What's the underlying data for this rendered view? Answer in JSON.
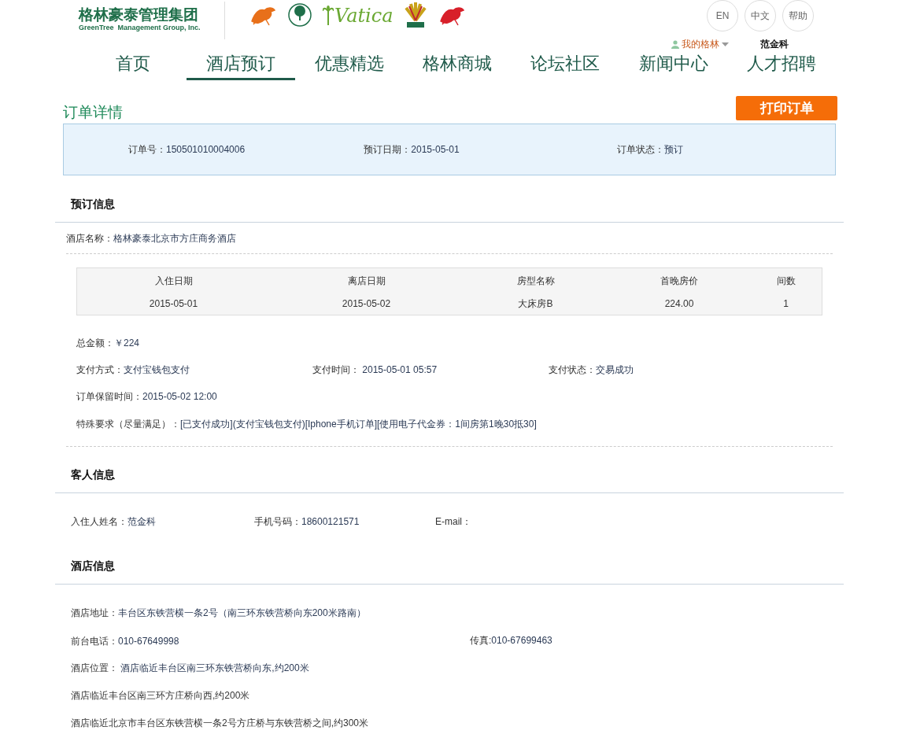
{
  "header": {
    "logo": {
      "title": "格林豪泰管理集团",
      "subtitle": "GreenTree  Management Group, Inc."
    },
    "brands": [
      {
        "kind": "dragon",
        "color": "#e8701a"
      },
      {
        "kind": "tree",
        "color": "#1f6f4a"
      },
      {
        "kind": "vatica",
        "color": "#6aa832",
        "text": "Vatica"
      },
      {
        "kind": "fan",
        "color": "#c9a21a"
      },
      {
        "kind": "dragon",
        "color": "#d8202a"
      }
    ],
    "lang_buttons": [
      "EN",
      "中文",
      "帮助"
    ],
    "user_menu": "我的格林",
    "user_name": "范金科"
  },
  "nav": [
    {
      "label": "首页",
      "selected": false
    },
    {
      "label": "酒店预订",
      "selected": true
    },
    {
      "label": "优惠精选",
      "selected": false
    },
    {
      "label": "格林商城",
      "selected": false
    },
    {
      "label": "论坛社区",
      "selected": false
    },
    {
      "label": "新闻中心",
      "selected": false
    },
    {
      "label": "人才招聘",
      "selected": false
    }
  ],
  "page_title": "订单详情",
  "print_button": "打印订单",
  "summary": [
    {
      "label": "订单号：",
      "value": "150501010004006"
    },
    {
      "label": "预订日期：",
      "value": "2015-05-01"
    },
    {
      "label": "订单状态：",
      "value": "预订"
    }
  ],
  "booking": {
    "heading": "预订信息",
    "hotel_name": {
      "label": "酒店名称：",
      "value": "格林豪泰北京市方庄商务酒店"
    },
    "table": {
      "columns": [
        "入住日期",
        "离店日期",
        "房型名称",
        "首晚房价",
        "间数"
      ],
      "rows": [
        [
          "2015-05-01",
          "2015-05-02",
          "大床房B",
          "224.00",
          "1"
        ]
      ]
    },
    "total": {
      "label": "总金额：",
      "value": "￥224"
    },
    "payment": [
      {
        "label": "支付方式：",
        "value": "支付宝钱包支付"
      },
      {
        "label": "支付时间：",
        "value": " 2015-05-01 05:57"
      },
      {
        "label": "支付状态：",
        "value": "交易成功"
      }
    ],
    "hold_time": {
      "label": "订单保留时间：",
      "value": "2015-05-02 12:00"
    },
    "special": {
      "label": "特殊要求（尽量满足）：",
      "value": "[已支付成功](支付宝钱包支付)[Iphone手机订单][使用电子代金券：1间房第1晚30抵30]"
    }
  },
  "guest": {
    "heading": "客人信息",
    "fields": [
      {
        "label": "入住人姓名：",
        "value": "范金科"
      },
      {
        "label": "手机号码：",
        "value": "18600121571"
      },
      {
        "label": "E-mail："
      }
    ]
  },
  "hotel": {
    "heading": "酒店信息",
    "address": {
      "label": "酒店地址：",
      "value": "丰台区东铁营横一条2号（南三环东铁营桥向东200米路南）"
    },
    "phone": {
      "label": "前台电话：",
      "value": "010-67649998"
    },
    "fax": {
      "label": "传真:",
      "value": "010-67699463"
    },
    "location": {
      "label": "酒店位置：",
      "value": " 酒店临近丰台区南三环东铁营桥向东,约200米"
    },
    "notes": [
      "酒店临近丰台区南三环方庄桥向西,约200米",
      "酒店临近北京市丰台区东铁营横一条2号方庄桥与东铁营桥之间,约300米"
    ]
  }
}
